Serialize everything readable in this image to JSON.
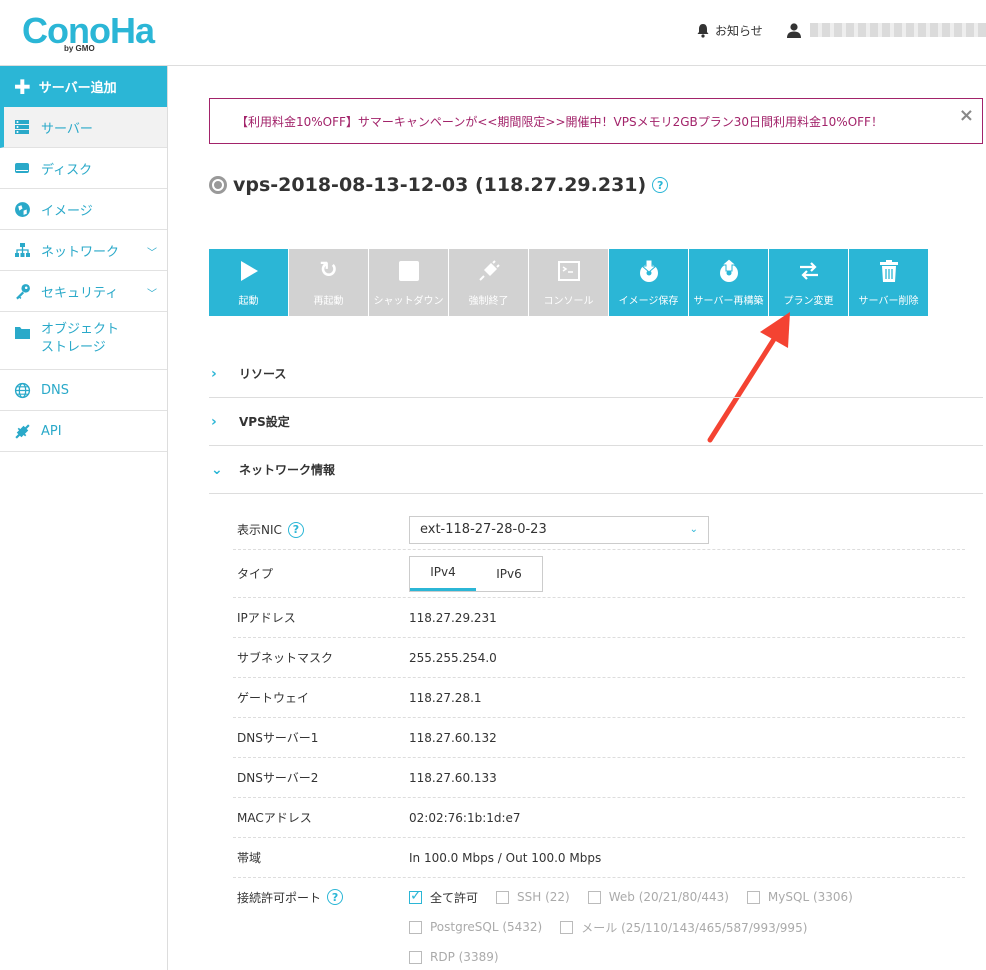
{
  "header": {
    "logo": "ConoHa",
    "logo_sub": "by GMO",
    "notice": "お知らせ",
    "bell_icon": "bell-icon",
    "user_icon": "user-icon"
  },
  "sidebar": {
    "add_label": "サーバー追加",
    "items": [
      {
        "label": "サーバー",
        "icon": "server-icon"
      },
      {
        "label": "ディスク",
        "icon": "disk-icon"
      },
      {
        "label": "イメージ",
        "icon": "globe-icon"
      },
      {
        "label": "ネットワーク",
        "icon": "network-icon"
      },
      {
        "label": "セキュリティ",
        "icon": "key-icon"
      },
      {
        "label": "オブジェクト\nストレージ",
        "icon": "folder-icon"
      },
      {
        "label": "DNS",
        "icon": "dns-globe-icon"
      },
      {
        "label": "API",
        "icon": "api-icon"
      }
    ]
  },
  "banner": {
    "text": "【利用料金10%OFF】サマーキャンペーンが<<期間限定>>開催中！VPSメモリ2GBプラン30日間利用料金10%OFF！",
    "close": "×"
  },
  "server": {
    "title": "vps-2018-08-13-12-03 (118.27.29.231)"
  },
  "toolbar": [
    {
      "label": "起動",
      "glyph": "▶",
      "enabled": true
    },
    {
      "label": "再起動",
      "glyph": "↻",
      "enabled": false
    },
    {
      "label": "シャットダウン",
      "glyph": "■",
      "enabled": false
    },
    {
      "label": "強制終了",
      "glyph": "⚡",
      "enabled": false
    },
    {
      "label": "コンソール",
      "glyph": "▭",
      "enabled": false
    },
    {
      "label": "イメージ保存",
      "glyph": "⬇",
      "enabled": true
    },
    {
      "label": "サーバー再構築",
      "glyph": "⬆",
      "enabled": true
    },
    {
      "label": "プラン変更",
      "glyph": "⇄",
      "enabled": true
    },
    {
      "label": "サーバー削除",
      "glyph": "🗑",
      "enabled": true
    }
  ],
  "accordion": {
    "resources": "リソース",
    "vps_settings": "VPS設定",
    "network_info": "ネットワーク情報"
  },
  "network": {
    "nic_label": "表示NIC",
    "nic_value": "ext-118-27-28-0-23",
    "type_label": "タイプ",
    "tab_ipv4": "IPv4",
    "tab_ipv6": "IPv6",
    "ip_label": "IPアドレス",
    "ip_value": "118.27.29.231",
    "subnet_label": "サブネットマスク",
    "subnet_value": "255.255.254.0",
    "gateway_label": "ゲートウェイ",
    "gateway_value": "118.27.28.1",
    "dns1_label": "DNSサーバー1",
    "dns1_value": "118.27.60.132",
    "dns2_label": "DNSサーバー2",
    "dns2_value": "118.27.60.133",
    "mac_label": "MACアドレス",
    "mac_value": "02:02:76:1b:1d:e7",
    "bandwidth_label": "帯域",
    "bandwidth_value": "In 100.0 Mbps / Out 100.0 Mbps",
    "ports_label": "接続許可ポート",
    "ports": {
      "all": "全て許可",
      "ssh": "SSH (22)",
      "web": "Web (20/21/80/443)",
      "mysql": "MySQL (3306)",
      "postgres": "PostgreSQL (5432)",
      "mail": "メール (25/110/143/465/587/993/995)",
      "rdp": "RDP (3389)"
    }
  },
  "colors": {
    "accent": "#2bb6d6",
    "banner": "#a2236a",
    "disabled": "#d2d2d2",
    "arrow": "#f44332"
  }
}
